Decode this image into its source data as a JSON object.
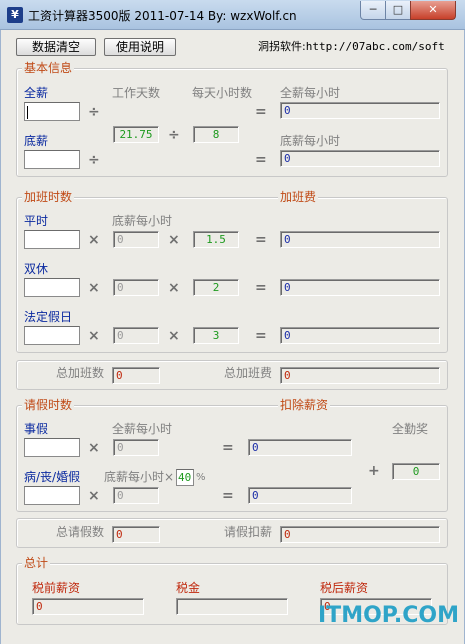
{
  "window": {
    "title": "工资计算器3500版  2011-07-14  By: wzxWolf.cn",
    "min_glyph": "─",
    "max_glyph": "□",
    "close_glyph": "✕"
  },
  "toolbar": {
    "clear_label": "数据清空",
    "help_label": "使用说明",
    "link_label": "洞拐软件:",
    "link_url": "http://07abc.com/soft"
  },
  "basic": {
    "legend": "基本信息",
    "full_salary_label": "全薪",
    "full_salary_value": "",
    "work_days_label": "工作天数",
    "hours_per_day_label": "每天小时数",
    "full_hourly_label": "全薪每小时",
    "work_days_value": "21.75",
    "hours_per_day_value": "8",
    "full_hourly_value": "0",
    "base_salary_label": "底薪",
    "base_salary_value": "",
    "base_hourly_label": "底薪每小时",
    "base_hourly_value": "0",
    "div_symbol": "÷",
    "eq_symbol": "="
  },
  "overtime": {
    "legend": "加班时数",
    "pay_legend": "加班费",
    "base_hourly_col_label": "底薪每小时",
    "mult_symbol": "×",
    "eq_symbol": "=",
    "rows": [
      {
        "label": "平时",
        "hours": "",
        "base_hourly": "0",
        "multiplier": "1.5",
        "pay": "0"
      },
      {
        "label": "双休",
        "hours": "",
        "base_hourly": "0",
        "multiplier": "2",
        "pay": "0"
      },
      {
        "label": "法定假日",
        "hours": "",
        "base_hourly": "0",
        "multiplier": "3",
        "pay": "0"
      }
    ],
    "total_hours_label": "总加班数",
    "total_hours_value": "0",
    "total_pay_label": "总加班费",
    "total_pay_value": "0"
  },
  "leave": {
    "legend": "请假时数",
    "deduct_legend": "扣除薪资",
    "full_hourly_col_label": "全薪每小时",
    "personal_label": "事假",
    "personal_hours": "",
    "personal_full_hourly": "0",
    "personal_deduct": "0",
    "sick_label": "病/丧/婚假",
    "sick_hours": "",
    "sick_base_hourly_label": "底薪每小时×",
    "sick_percent": "40",
    "percent_sign": "%",
    "sick_base_hourly": "0",
    "sick_deduct": "0",
    "attendance_bonus_label": "全勤奖",
    "attendance_bonus_value": "0",
    "plus_symbol": "+",
    "total_leave_label": "总请假数",
    "total_leave_value": "0",
    "total_deduct_label": "请假扣薪",
    "total_deduct_value": "0"
  },
  "total": {
    "legend": "总计",
    "pretax_label": "税前薪资",
    "pretax_value": "0",
    "tax_label": "税金",
    "tax_value": "",
    "aftertax_label": "税后薪资",
    "aftertax_value": "0"
  },
  "watermark": "ITMOP.COM",
  "colors": {
    "legend": "#c04a16",
    "label_blue": "#0b2aa0",
    "value_green": "#1f9a1f",
    "value_red": "#c0290e",
    "watermark": "#2fa4c8"
  }
}
